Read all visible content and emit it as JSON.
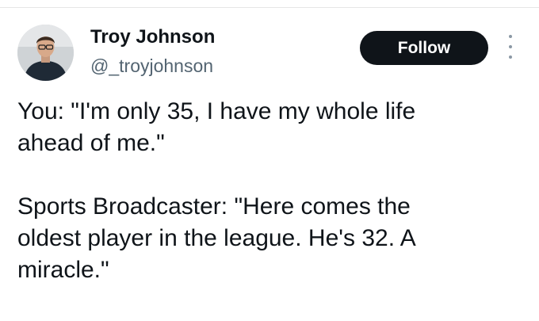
{
  "author": {
    "name": "Troy Johnson",
    "handle": "@_troyjohnson",
    "avatar_icon": "profile-photo"
  },
  "actions": {
    "follow_label": "Follow",
    "more_icon": "more-options-icon"
  },
  "tweet": {
    "text": "You: \"I'm only 35, I have my whole life\nahead of me.\"\n\nSports Broadcaster: \"Here comes the\noldest player in the league. He's 32. A\nmiracle.\""
  },
  "colors": {
    "text_primary": "#0f1419",
    "text_secondary": "#536471",
    "follow_bg": "#0f1419",
    "follow_text": "#ffffff"
  }
}
